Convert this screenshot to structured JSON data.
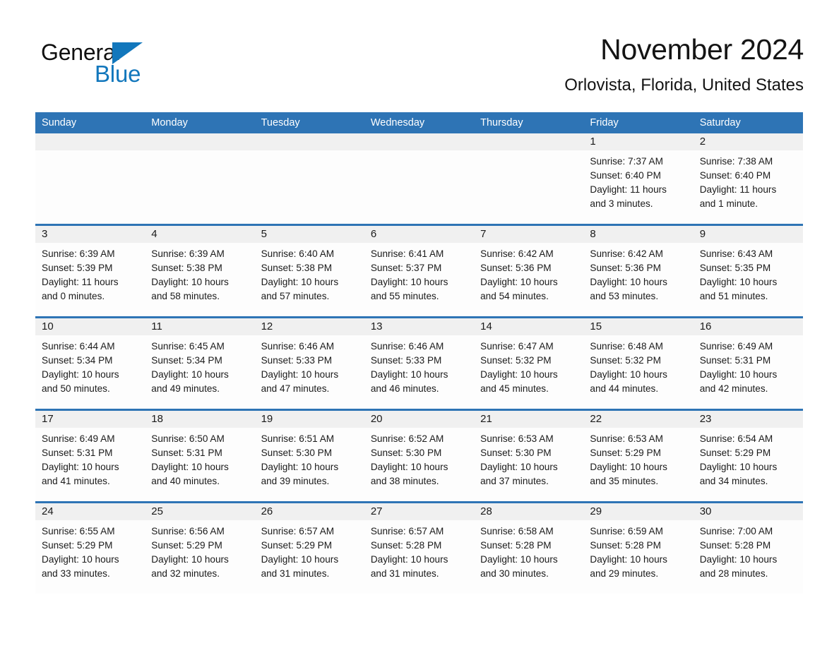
{
  "brand": {
    "name_part1": "General",
    "name_part2": "Blue",
    "triangle_color": "#1277bc",
    "logo_icon": "general-blue-logo"
  },
  "header": {
    "month_title": "November 2024",
    "location": "Orlovista, Florida, United States"
  },
  "theme": {
    "header_blue": "#2e74b5",
    "day_band_gray": "#f0f0f0",
    "text_color": "#1a1a1a",
    "page_background": "#ffffff"
  },
  "calendar": {
    "weekdays": [
      "Sunday",
      "Monday",
      "Tuesday",
      "Wednesday",
      "Thursday",
      "Friday",
      "Saturday"
    ],
    "weeks": [
      [
        {
          "day": "",
          "lines": []
        },
        {
          "day": "",
          "lines": []
        },
        {
          "day": "",
          "lines": []
        },
        {
          "day": "",
          "lines": []
        },
        {
          "day": "",
          "lines": []
        },
        {
          "day": "1",
          "lines": [
            "Sunrise: 7:37 AM",
            "Sunset: 6:40 PM",
            "Daylight: 11 hours",
            "and 3 minutes."
          ]
        },
        {
          "day": "2",
          "lines": [
            "Sunrise: 7:38 AM",
            "Sunset: 6:40 PM",
            "Daylight: 11 hours",
            "and 1 minute."
          ]
        }
      ],
      [
        {
          "day": "3",
          "lines": [
            "Sunrise: 6:39 AM",
            "Sunset: 5:39 PM",
            "Daylight: 11 hours",
            "and 0 minutes."
          ]
        },
        {
          "day": "4",
          "lines": [
            "Sunrise: 6:39 AM",
            "Sunset: 5:38 PM",
            "Daylight: 10 hours",
            "and 58 minutes."
          ]
        },
        {
          "day": "5",
          "lines": [
            "Sunrise: 6:40 AM",
            "Sunset: 5:38 PM",
            "Daylight: 10 hours",
            "and 57 minutes."
          ]
        },
        {
          "day": "6",
          "lines": [
            "Sunrise: 6:41 AM",
            "Sunset: 5:37 PM",
            "Daylight: 10 hours",
            "and 55 minutes."
          ]
        },
        {
          "day": "7",
          "lines": [
            "Sunrise: 6:42 AM",
            "Sunset: 5:36 PM",
            "Daylight: 10 hours",
            "and 54 minutes."
          ]
        },
        {
          "day": "8",
          "lines": [
            "Sunrise: 6:42 AM",
            "Sunset: 5:36 PM",
            "Daylight: 10 hours",
            "and 53 minutes."
          ]
        },
        {
          "day": "9",
          "lines": [
            "Sunrise: 6:43 AM",
            "Sunset: 5:35 PM",
            "Daylight: 10 hours",
            "and 51 minutes."
          ]
        }
      ],
      [
        {
          "day": "10",
          "lines": [
            "Sunrise: 6:44 AM",
            "Sunset: 5:34 PM",
            "Daylight: 10 hours",
            "and 50 minutes."
          ]
        },
        {
          "day": "11",
          "lines": [
            "Sunrise: 6:45 AM",
            "Sunset: 5:34 PM",
            "Daylight: 10 hours",
            "and 49 minutes."
          ]
        },
        {
          "day": "12",
          "lines": [
            "Sunrise: 6:46 AM",
            "Sunset: 5:33 PM",
            "Daylight: 10 hours",
            "and 47 minutes."
          ]
        },
        {
          "day": "13",
          "lines": [
            "Sunrise: 6:46 AM",
            "Sunset: 5:33 PM",
            "Daylight: 10 hours",
            "and 46 minutes."
          ]
        },
        {
          "day": "14",
          "lines": [
            "Sunrise: 6:47 AM",
            "Sunset: 5:32 PM",
            "Daylight: 10 hours",
            "and 45 minutes."
          ]
        },
        {
          "day": "15",
          "lines": [
            "Sunrise: 6:48 AM",
            "Sunset: 5:32 PM",
            "Daylight: 10 hours",
            "and 44 minutes."
          ]
        },
        {
          "day": "16",
          "lines": [
            "Sunrise: 6:49 AM",
            "Sunset: 5:31 PM",
            "Daylight: 10 hours",
            "and 42 minutes."
          ]
        }
      ],
      [
        {
          "day": "17",
          "lines": [
            "Sunrise: 6:49 AM",
            "Sunset: 5:31 PM",
            "Daylight: 10 hours",
            "and 41 minutes."
          ]
        },
        {
          "day": "18",
          "lines": [
            "Sunrise: 6:50 AM",
            "Sunset: 5:31 PM",
            "Daylight: 10 hours",
            "and 40 minutes."
          ]
        },
        {
          "day": "19",
          "lines": [
            "Sunrise: 6:51 AM",
            "Sunset: 5:30 PM",
            "Daylight: 10 hours",
            "and 39 minutes."
          ]
        },
        {
          "day": "20",
          "lines": [
            "Sunrise: 6:52 AM",
            "Sunset: 5:30 PM",
            "Daylight: 10 hours",
            "and 38 minutes."
          ]
        },
        {
          "day": "21",
          "lines": [
            "Sunrise: 6:53 AM",
            "Sunset: 5:30 PM",
            "Daylight: 10 hours",
            "and 37 minutes."
          ]
        },
        {
          "day": "22",
          "lines": [
            "Sunrise: 6:53 AM",
            "Sunset: 5:29 PM",
            "Daylight: 10 hours",
            "and 35 minutes."
          ]
        },
        {
          "day": "23",
          "lines": [
            "Sunrise: 6:54 AM",
            "Sunset: 5:29 PM",
            "Daylight: 10 hours",
            "and 34 minutes."
          ]
        }
      ],
      [
        {
          "day": "24",
          "lines": [
            "Sunrise: 6:55 AM",
            "Sunset: 5:29 PM",
            "Daylight: 10 hours",
            "and 33 minutes."
          ]
        },
        {
          "day": "25",
          "lines": [
            "Sunrise: 6:56 AM",
            "Sunset: 5:29 PM",
            "Daylight: 10 hours",
            "and 32 minutes."
          ]
        },
        {
          "day": "26",
          "lines": [
            "Sunrise: 6:57 AM",
            "Sunset: 5:29 PM",
            "Daylight: 10 hours",
            "and 31 minutes."
          ]
        },
        {
          "day": "27",
          "lines": [
            "Sunrise: 6:57 AM",
            "Sunset: 5:28 PM",
            "Daylight: 10 hours",
            "and 31 minutes."
          ]
        },
        {
          "day": "28",
          "lines": [
            "Sunrise: 6:58 AM",
            "Sunset: 5:28 PM",
            "Daylight: 10 hours",
            "and 30 minutes."
          ]
        },
        {
          "day": "29",
          "lines": [
            "Sunrise: 6:59 AM",
            "Sunset: 5:28 PM",
            "Daylight: 10 hours",
            "and 29 minutes."
          ]
        },
        {
          "day": "30",
          "lines": [
            "Sunrise: 7:00 AM",
            "Sunset: 5:28 PM",
            "Daylight: 10 hours",
            "and 28 minutes."
          ]
        }
      ]
    ]
  }
}
